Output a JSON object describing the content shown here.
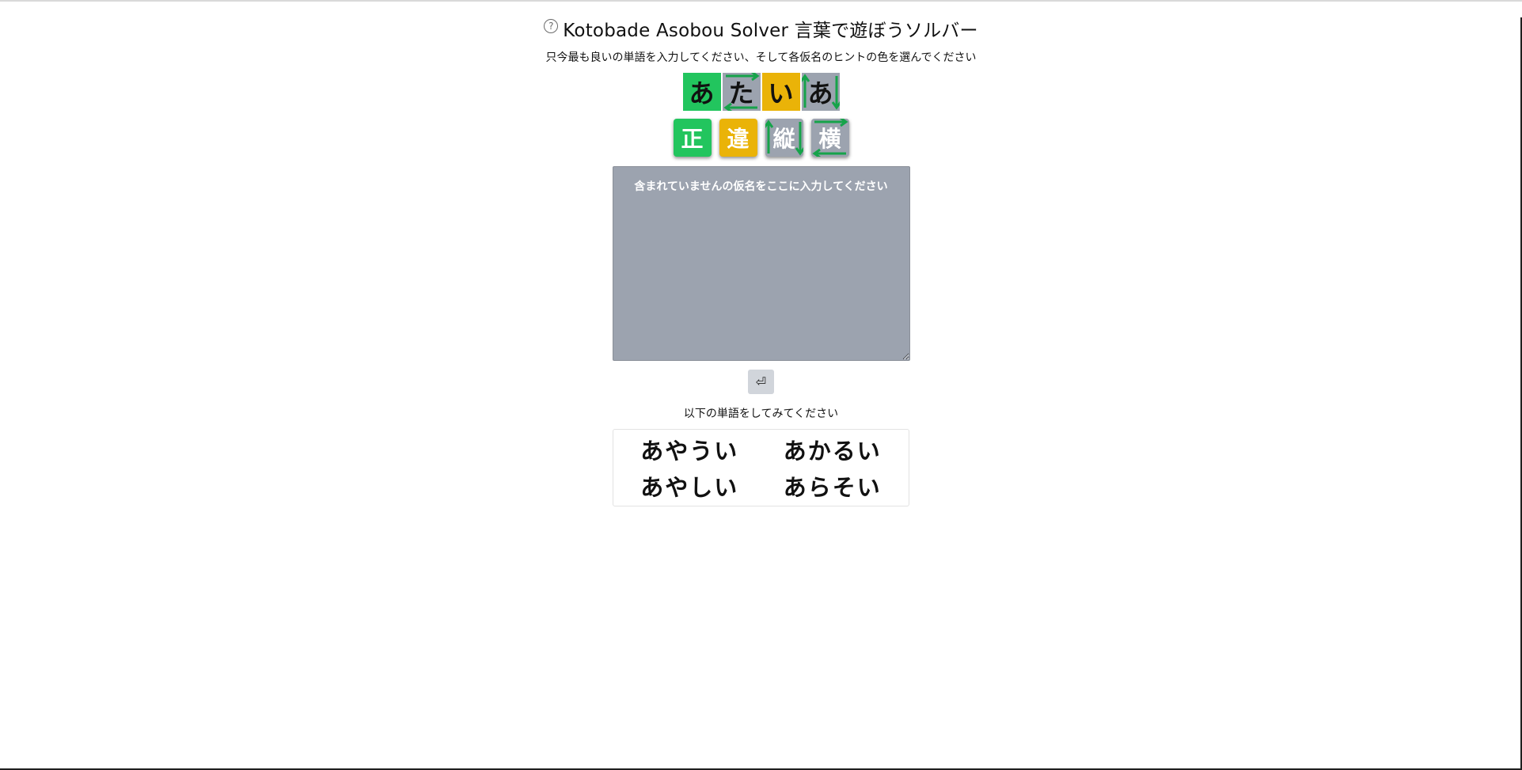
{
  "header": {
    "title": "Kotobade Asobou Solver 言葉で遊ぼうソルバー",
    "help_icon": "help-circle-icon",
    "help_glyph": "?"
  },
  "instructions": {
    "subtitle": "只今最も良いの単語を入力してください、そして各仮名のヒントの色を選んでください"
  },
  "guess": {
    "tiles": [
      {
        "char": "あ",
        "state": "correct",
        "arrows": "none"
      },
      {
        "char": "た",
        "state": "absent",
        "arrows": "horizontal"
      },
      {
        "char": "い",
        "state": "present",
        "arrows": "none"
      },
      {
        "char": "あ",
        "state": "absent",
        "arrows": "vertical"
      }
    ]
  },
  "legend": {
    "tiles": [
      {
        "label": "正",
        "color": "#22c55e",
        "arrows": "none"
      },
      {
        "label": "違",
        "color": "#eab308",
        "arrows": "none"
      },
      {
        "label": "縦",
        "color": "#9ca3af",
        "arrows": "vertical"
      },
      {
        "label": "横",
        "color": "#9ca3af",
        "arrows": "horizontal"
      }
    ]
  },
  "absent_input": {
    "placeholder": "含まれていませんの仮名をここに入力してください",
    "value": ""
  },
  "submit": {
    "label": "⏎"
  },
  "suggestions": {
    "label": "以下の単語をしてみてください",
    "words": [
      "あやうい",
      "あかるい",
      "あやしい",
      "あらそい"
    ]
  },
  "colors": {
    "correct": "#22c55e",
    "present": "#eab308",
    "absent": "#9ca3af",
    "arrow": "#16a34a"
  }
}
